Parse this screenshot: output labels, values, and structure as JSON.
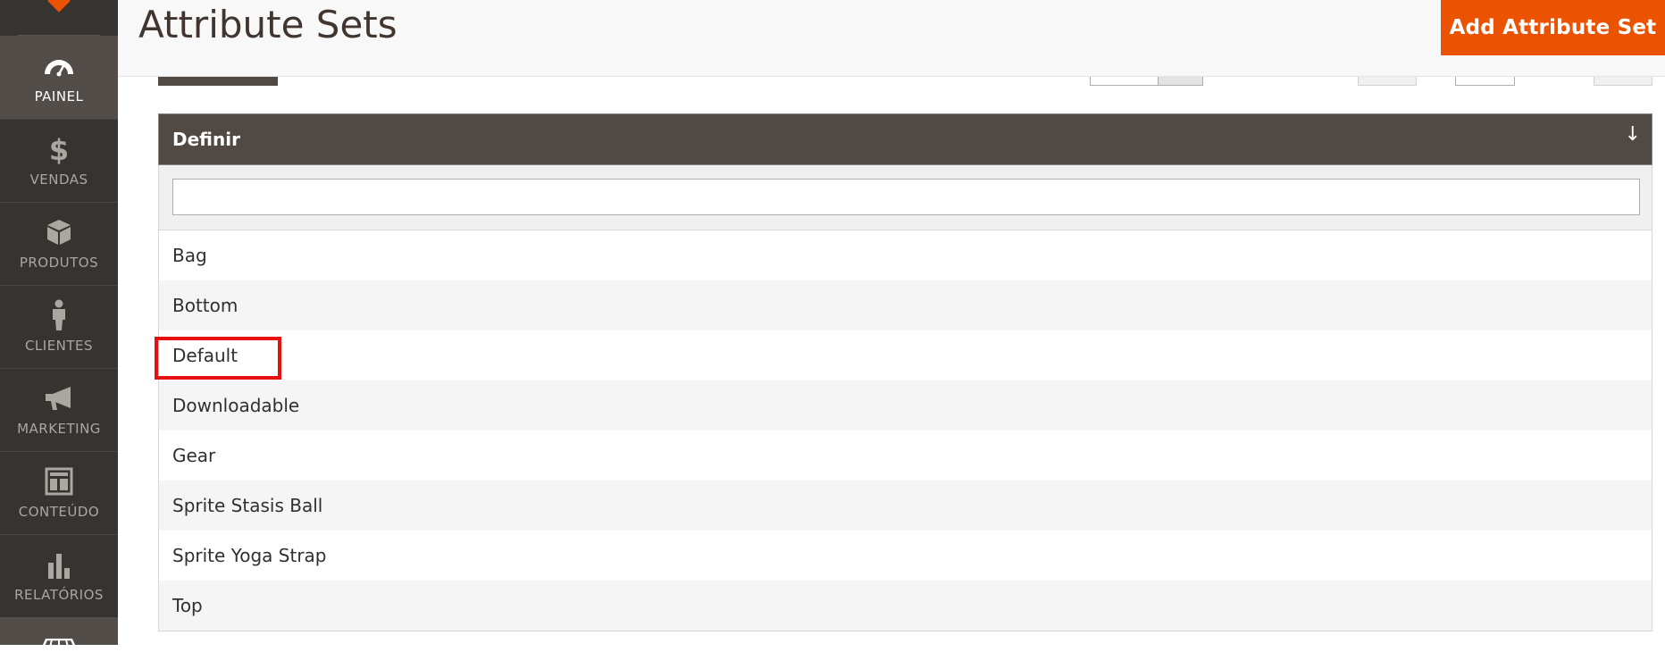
{
  "sidebar": {
    "items": [
      {
        "label": "PAINEL",
        "icon": "dashboard-gauge-icon",
        "active": true
      },
      {
        "label": "VENDAS",
        "icon": "dollar-icon"
      },
      {
        "label": "PRODUTOS",
        "icon": "box-icon"
      },
      {
        "label": "CLIENTES",
        "icon": "person-icon"
      },
      {
        "label": "MARKETING",
        "icon": "megaphone-icon"
      },
      {
        "label": "CONTEÚDO",
        "icon": "layout-icon"
      },
      {
        "label": "RELATÓRIOS",
        "icon": "bar-chart-icon"
      }
    ]
  },
  "header": {
    "title": "Attribute Sets",
    "add_button_label": "Add Attribute Set"
  },
  "grid": {
    "column_header": "Definir",
    "sort_indicator": "↓",
    "filter_value": "",
    "rows": [
      "Bag",
      "Bottom",
      "Default",
      "Downloadable",
      "Gear",
      "Sprite Stasis Ball",
      "Sprite Yoga Strap",
      "Top"
    ]
  },
  "colors": {
    "accent": "#eb5202",
    "sidebar_bg": "#373330",
    "grid_header_bg": "#514943",
    "highlight": "#e8100f"
  }
}
